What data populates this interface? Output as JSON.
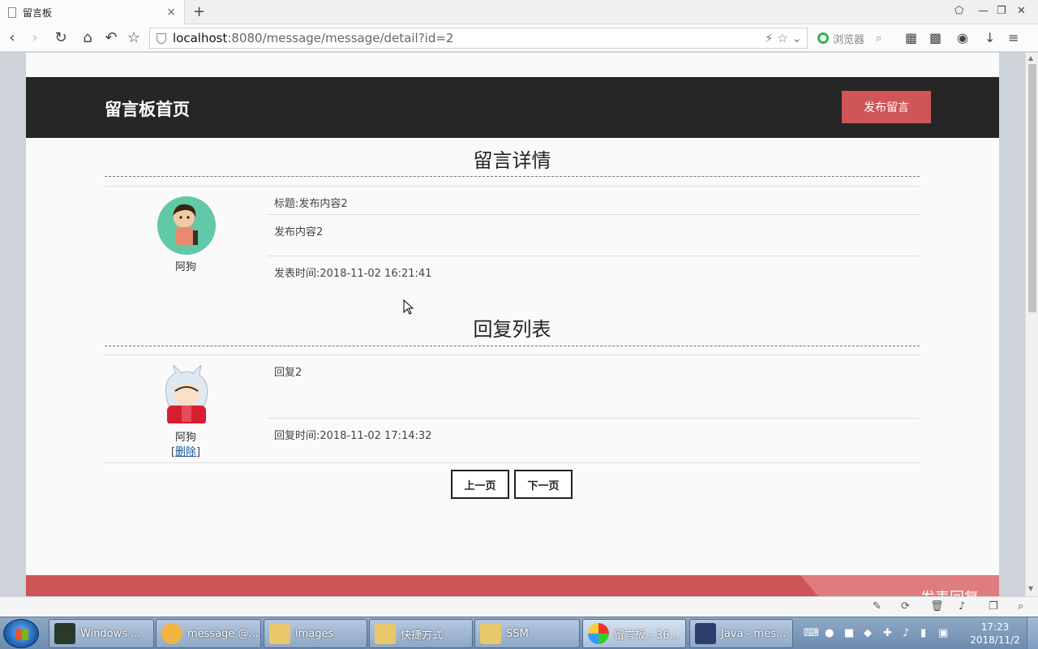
{
  "browser": {
    "tab_title": "留言板",
    "tab_close": "×",
    "new_tab": "+",
    "url_host": "localhost",
    "url_rest": ":8080/message/message/detail?id=2",
    "search_label": "浏览器"
  },
  "site": {
    "title": "留言板首页",
    "publish_button": "发布留言"
  },
  "detail": {
    "section_title": "留言详情",
    "author": "阿狗",
    "subject": "标题:发布内容2",
    "content": "发布内容2",
    "publish_time": "发表时间:2018-11-02 16:21:41"
  },
  "replies": {
    "section_title": "回复列表",
    "items": [
      {
        "author": "阿狗",
        "content": "回复2",
        "reply_time": "回复时间:2018-11-02 17:14:32",
        "delete_label": "删除"
      }
    ]
  },
  "pager": {
    "prev": "上一页",
    "next": "下一页"
  },
  "footer": {
    "reply_label": "发表回复"
  },
  "taskbar": {
    "items": [
      {
        "label": "Windows ..."
      },
      {
        "label": "message @..."
      },
      {
        "label": "images"
      },
      {
        "label": "快捷方式"
      },
      {
        "label": "SSM"
      },
      {
        "label": "留言板 - 36..."
      },
      {
        "label": "Java - mes..."
      }
    ],
    "clock_time": "17:23",
    "clock_date": "2018/11/2"
  },
  "colors": {
    "header_bg": "#262626",
    "accent": "#d05557",
    "footer_accent": "#cc5557"
  }
}
